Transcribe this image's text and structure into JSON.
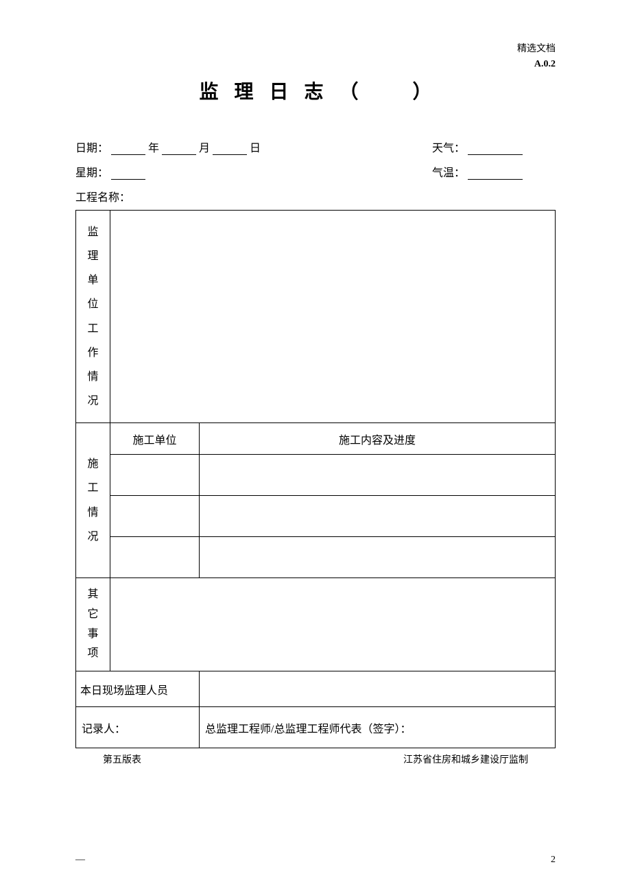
{
  "header": {
    "watermark": "精选文档",
    "code": "A.0.2"
  },
  "title": {
    "main": "监 理 日 志",
    "paren_open": "（",
    "paren_close": "）"
  },
  "meta": {
    "date_label": "日期：",
    "year_label": "年",
    "month_label": "月",
    "day_label": "日",
    "weather_label": "天气：",
    "weekday_label": "星期：",
    "temp_label": "气温：",
    "project_label": "工程名称："
  },
  "table": {
    "section1_label": "监理单位工作情况",
    "section2_label": "施工情况",
    "section2_col1": "施工单位",
    "section2_col2": "施工内容及进度",
    "section3_label": "其它事项",
    "personnel_label": "本日现场监理人员",
    "recorder_label": "记录人：",
    "signature_label": "总监理工程师/总监理工程师代表（签字）："
  },
  "footer": {
    "left": "第五版表",
    "right": "江苏省住房和城乡建设厅监制"
  },
  "page": {
    "dash": "—",
    "num": "2"
  }
}
